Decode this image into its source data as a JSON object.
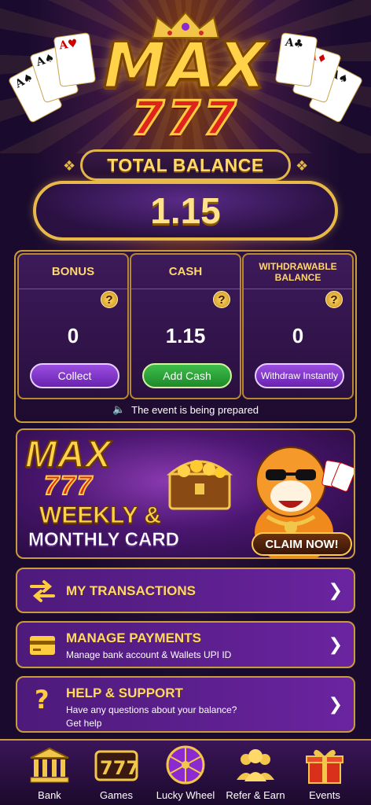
{
  "header": {
    "logo_word": "MAX",
    "logo_number": "777",
    "total_balance_label": "TOTAL BALANCE",
    "total_balance_value": "1.15"
  },
  "balances": [
    {
      "label": "BONUS",
      "value": "0",
      "button": "Collect"
    },
    {
      "label": "CASH",
      "value": "1.15",
      "button": "Add Cash"
    },
    {
      "label": "WITHDRAWABLE BALANCE",
      "value": "0",
      "button": "Withdraw Instantly"
    }
  ],
  "help_mark": "?",
  "event_text": "The event is being prepared",
  "banner": {
    "brand": "MAX",
    "brand_number": "777",
    "line1": "WEEKLY &",
    "line2": "MONTHLY CARD",
    "cta": "CLAIM NOW!"
  },
  "menu": {
    "transactions": {
      "title": "MY TRANSACTIONS"
    },
    "payments": {
      "title": "MANAGE PAYMENTS",
      "subtitle": "Manage bank account & Wallets UPI ID"
    },
    "support": {
      "title": "HELP & SUPPORT",
      "subtitle1": "Have any questions about your balance?",
      "subtitle2": "Get help"
    }
  },
  "nav": [
    {
      "label": "Bank",
      "icon": "bank-icon"
    },
    {
      "label": "Games",
      "icon": "slot-777-icon"
    },
    {
      "label": "Lucky Wheel",
      "icon": "wheel-icon"
    },
    {
      "label": "Refer & Earn",
      "icon": "people-icon"
    },
    {
      "label": "Events",
      "icon": "gift-icon"
    }
  ],
  "colors": {
    "gold": "#e8b948",
    "purple": "#5a1f8a",
    "green": "#2aa63a",
    "red": "#e0231c"
  }
}
